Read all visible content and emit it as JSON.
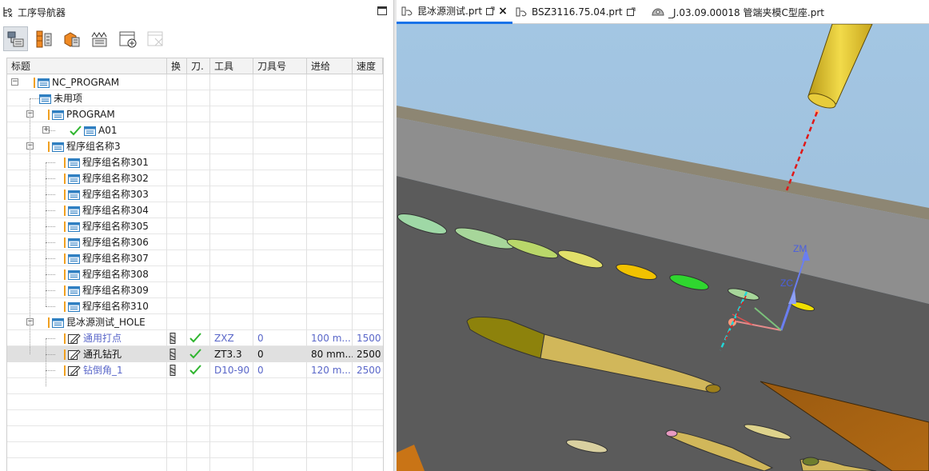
{
  "navigator": {
    "title": "工序导航器",
    "columns": [
      "标题",
      "换",
      "刀.",
      "工具",
      "刀具号",
      "进给",
      "速度"
    ],
    "tree": [
      {
        "label": "NC_PROGRAM"
      },
      {
        "label": "未用项"
      },
      {
        "label": "PROGRAM"
      },
      {
        "label": "A01"
      },
      {
        "label": "程序组名称3"
      },
      {
        "label": "程序组名称301"
      },
      {
        "label": "程序组名称302"
      },
      {
        "label": "程序组名称303"
      },
      {
        "label": "程序组名称304"
      },
      {
        "label": "程序组名称305"
      },
      {
        "label": "程序组名称306"
      },
      {
        "label": "程序组名称307"
      },
      {
        "label": "程序组名称308"
      },
      {
        "label": "程序组名称309"
      },
      {
        "label": "程序组名称310"
      },
      {
        "label": "昆冰源测试_HOLE"
      },
      {
        "label": "通用打点",
        "tool": "ZXZ",
        "tool_no": "0",
        "feed": "100 m...",
        "speed": "1500"
      },
      {
        "label": "通孔钻孔",
        "tool": "ZT3.3",
        "tool_no": "0",
        "feed": "80 mm...",
        "speed": "2500"
      },
      {
        "label": "钻倒角_1",
        "tool": "D10-90",
        "tool_no": "0",
        "feed": "120 m...",
        "speed": "2500"
      }
    ]
  },
  "tabs": [
    {
      "label": "昆冰源测试.prt"
    },
    {
      "label": "BSZ3116.75.04.prt"
    },
    {
      "label": "_J.03.09.00018 管端夹模C型座.prt"
    }
  ],
  "viewport": {
    "axis_labels": {
      "zm": "ZM",
      "zc": "ZC"
    }
  },
  "colors": {
    "accent": "#1a73e8",
    "warning": "#f0a020",
    "check": "#2fb52f",
    "op_text": "#5a67c9",
    "sky": "#9fc3e0",
    "part_top": "#8f8f8f",
    "part_face": "#5c5c5c"
  }
}
